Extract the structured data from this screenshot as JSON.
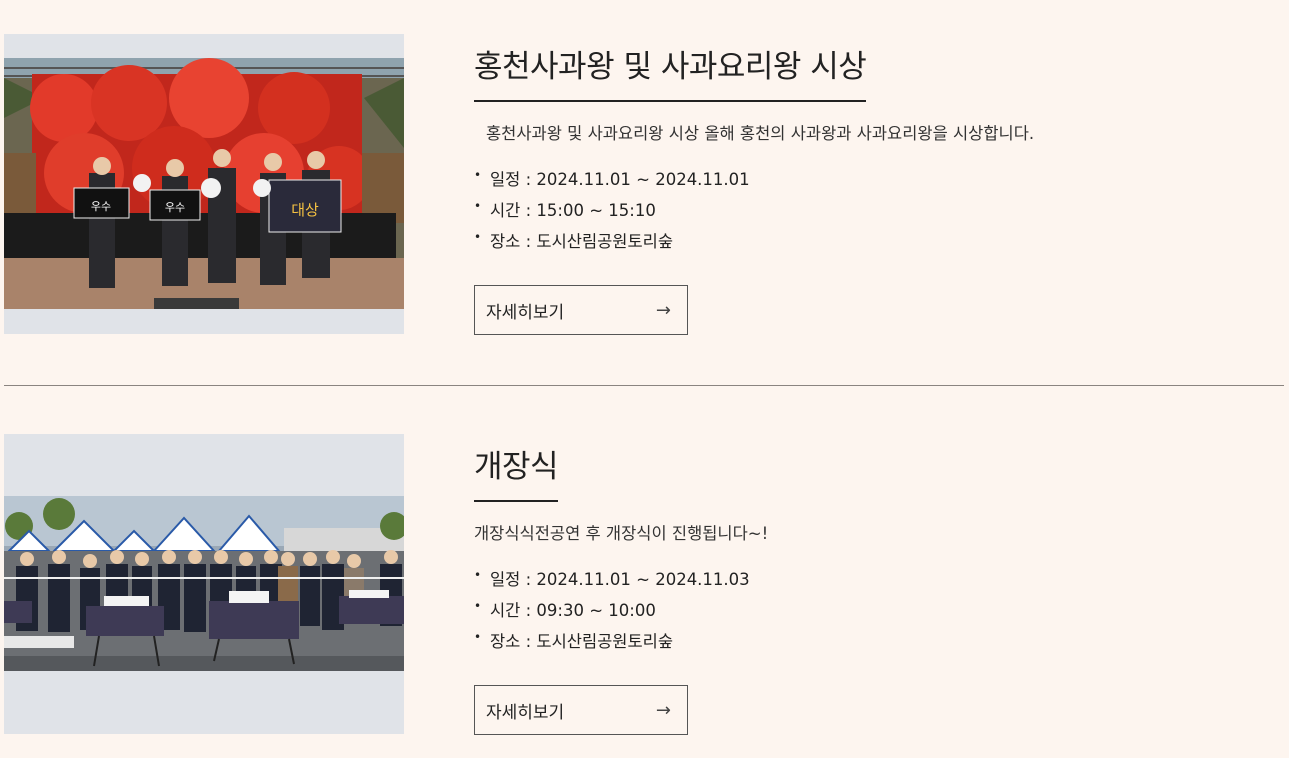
{
  "events": [
    {
      "title": "홍천사과왕 및 사과요리왕 시상",
      "description": "홍천사과왕 및 사과요리왕 시상 올해 홍천의 사과왕과 사과요리왕을 시상합니다.",
      "schedule": "일정 : 2024.11.01 ~ 2024.11.01",
      "time": "시간 : 15:00 ~ 15:10",
      "place": "장소 : 도시산림공원토리숲",
      "button_label": "자세히보기",
      "button_icon": "arrow-right-icon",
      "photo_sign_left": "우수",
      "photo_sign_center": "우수",
      "photo_sign_right": "대상"
    },
    {
      "title": "개장식",
      "description": "개장식식전공연 후 개장식이 진행됩니다~!",
      "schedule": "일정 : 2024.11.01 ~ 2024.11.03",
      "time": "시간 : 09:30 ~ 10:00",
      "place": "장소 : 도시산림공원토리숲",
      "button_label": "자세히보기",
      "button_icon": "arrow-right-icon"
    }
  ],
  "colors": {
    "background": "#fdf5ef",
    "photo_frame": "#e0e3e8",
    "divider": "#8a8480"
  }
}
